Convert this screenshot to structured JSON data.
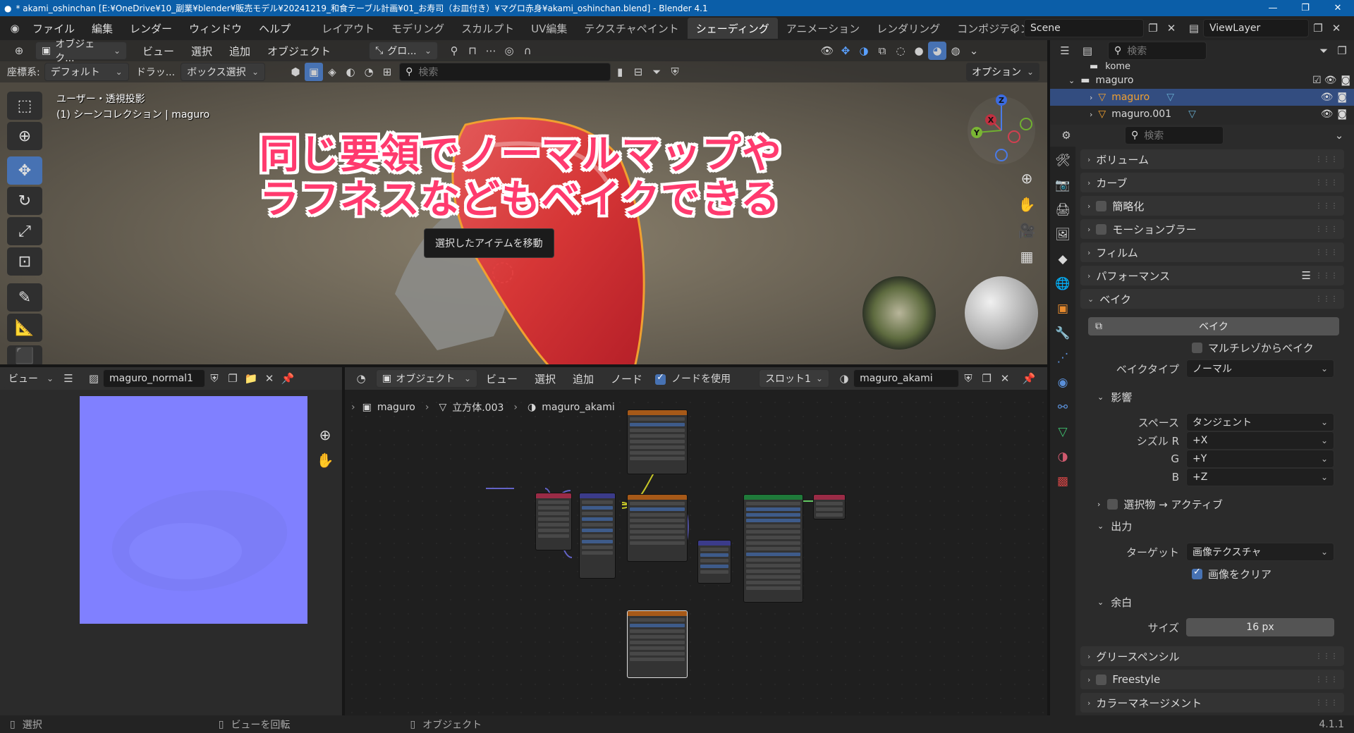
{
  "titlebar": {
    "title": "* akami_oshinchan [E:¥OneDrive¥10_副業¥blender¥販売モデル¥20241219_和食テーブル計画¥01_お寿司（お皿付き）¥マグロ赤身¥akami_oshinchan.blend] - Blender 4.1"
  },
  "menu": {
    "file": "ファイル",
    "edit": "編集",
    "render": "レンダー",
    "window": "ウィンドウ",
    "help": "ヘルプ"
  },
  "workspaces": [
    "レイアウト",
    "モデリング",
    "スカルプト",
    "UV編集",
    "テクスチャペイント",
    "シェーディング",
    "アニメーション",
    "レンダリング",
    "コンポジティング"
  ],
  "active_workspace": "シェーディング",
  "scene": {
    "name": "Scene",
    "viewlayer": "ViewLayer"
  },
  "viewport": {
    "mode": "オブジェク...",
    "view": "ビュー",
    "select": "選択",
    "add": "追加",
    "object": "オブジェクト",
    "transform_orient": "グロ...",
    "coord_label": "座標系:",
    "coord_value": "デフォルト",
    "drag_label": "ドラッ...",
    "drag_value": "ボックス選択",
    "search_placeholder": "検索",
    "options": "オプション",
    "view_name": "ユーザー・透視投影",
    "collection_info": "(1) シーンコレクション | maguro",
    "tooltip": "選択したアイテムを移動",
    "overlay_line1": "同じ要領でノーマルマップや",
    "overlay_line2": "ラフネスなどもベイクできる",
    "gizmo": {
      "x": "X",
      "y": "Y",
      "z": "Z"
    }
  },
  "image_editor": {
    "view": "ビュー",
    "image_name": "maguro_normal1"
  },
  "node_editor": {
    "object_mode": "オブジェクト",
    "view": "ビュー",
    "select": "選択",
    "add": "追加",
    "node": "ノード",
    "use_nodes": "ノードを使用",
    "slot": "スロット1",
    "material": "maguro_akami",
    "breadcrumb": [
      "maguro",
      "立方体.003",
      "maguro_akami"
    ]
  },
  "outliner": {
    "search_placeholder": "検索",
    "items": [
      {
        "name": "kome"
      },
      {
        "name": "maguro"
      },
      {
        "name": "maguro"
      },
      {
        "name": "maguro.001"
      }
    ]
  },
  "properties": {
    "search_placeholder": "検索",
    "panels": {
      "volume": "ボリューム",
      "curves": "カーブ",
      "simplify": "簡略化",
      "motion_blur": "モーションブラー",
      "film": "フィルム",
      "performance": "パフォーマンス",
      "bake": "ベイク",
      "grease_pencil": "グリースペンシル",
      "freestyle": "Freestyle",
      "color_mgmt": "カラーマネージメント"
    },
    "bake_button": "ベイク",
    "multires": "マルチレゾからベイク",
    "bake_type_label": "ベイクタイプ",
    "bake_type": "ノーマル",
    "influence": "影響",
    "space_label": "スペース",
    "space": "タンジェント",
    "swizzle_r_label": "シズル R",
    "swizzle_r": "+X",
    "swizzle_g_label": "G",
    "swizzle_g": "+Y",
    "swizzle_b_label": "B",
    "swizzle_b": "+Z",
    "selected_to_active": "選択物 → アクティブ",
    "output": "出力",
    "target_label": "ターゲット",
    "target": "画像テクスチャ",
    "clear_image": "画像をクリア",
    "margin": "余白",
    "size_label": "サイズ",
    "size": "16 px"
  },
  "status": {
    "select": "選択",
    "rotate": "ビューを回転",
    "object": "オブジェクト",
    "version": "4.1.1"
  },
  "colors": {
    "accent": "#4772b3",
    "overlay_text": "#ff3a6e",
    "normal_map": "#8080ff",
    "titlebar": "#0b5ea8"
  }
}
